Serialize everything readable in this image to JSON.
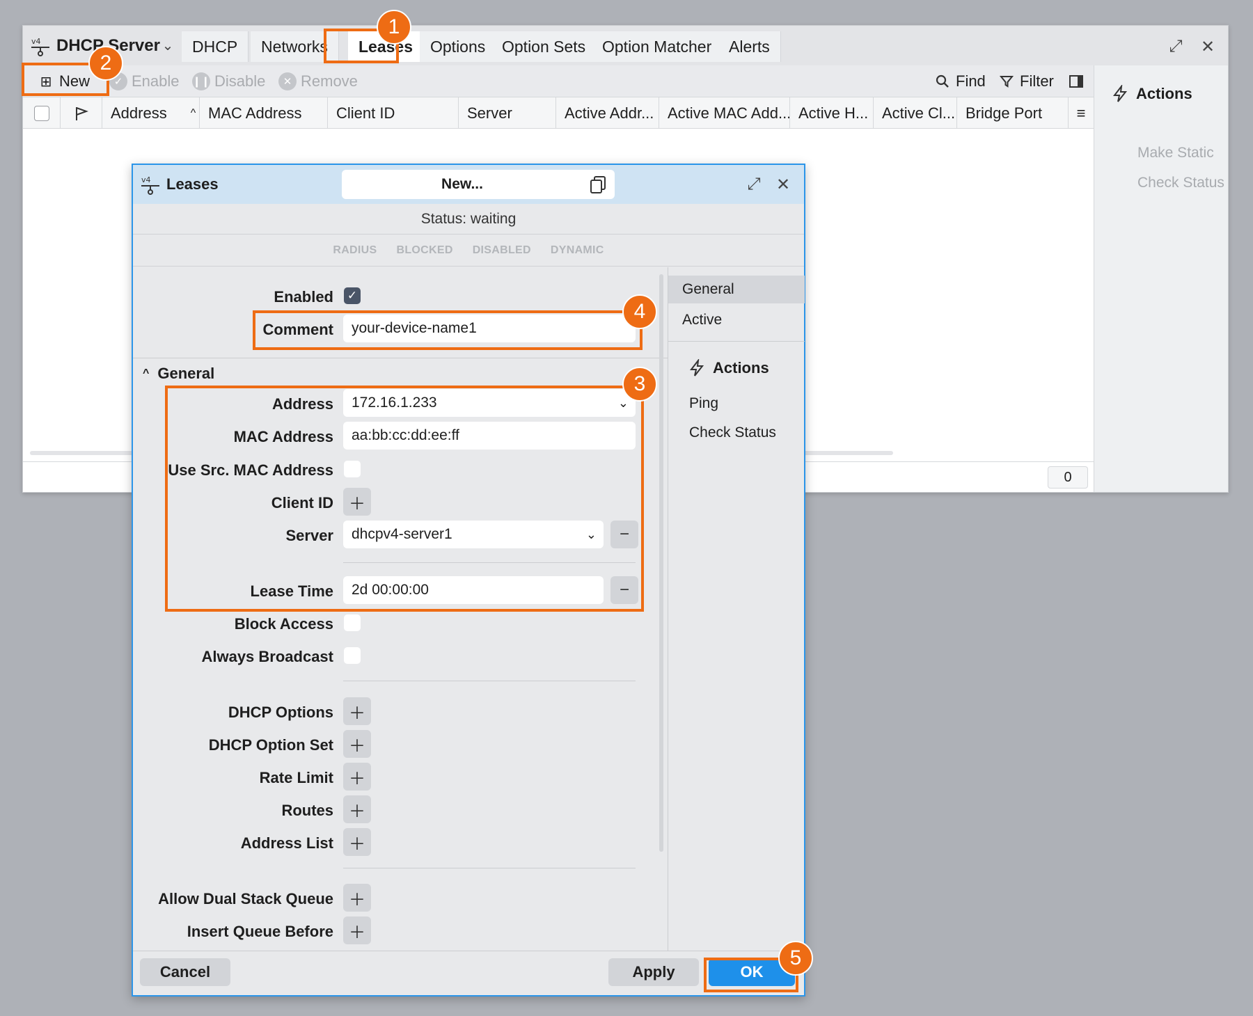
{
  "main": {
    "title": "DHCP Server",
    "tabs": [
      "DHCP",
      "Networks",
      "Leases",
      "Options",
      "Option Sets",
      "Option Matcher",
      "Alerts"
    ],
    "active_tab": "Leases",
    "toolbar": {
      "new": "New",
      "enable": "Enable",
      "disable": "Disable",
      "remove": "Remove",
      "find": "Find",
      "filter": "Filter"
    },
    "columns": [
      "Address",
      "MAC Address",
      "Client ID",
      "Server",
      "Active Addr...",
      "Active MAC Add...",
      "Active H...",
      "Active Cl...",
      "Bridge Port"
    ],
    "side_panel": {
      "header": "Actions",
      "items": [
        "Make Static",
        "Check Status"
      ]
    },
    "row_count": "0"
  },
  "dialog": {
    "title": "Leases",
    "name": "New...",
    "status": "Status: waiting",
    "flags": [
      "RADIUS",
      "BLOCKED",
      "DISABLED",
      "DYNAMIC"
    ],
    "fields": {
      "enabled_label": "Enabled",
      "comment_label": "Comment",
      "comment_value": "your-device-name1",
      "section_general": "General",
      "address_label": "Address",
      "address_value": "172.16.1.233",
      "mac_label": "MAC Address",
      "mac_value": "aa:bb:cc:dd:ee:ff",
      "use_src_mac_label": "Use Src. MAC Address",
      "client_id_label": "Client ID",
      "server_label": "Server",
      "server_value": "dhcpv4-server1",
      "lease_time_label": "Lease Time",
      "lease_time_value": "2d 00:00:00",
      "block_access_label": "Block Access",
      "always_broadcast_label": "Always Broadcast",
      "dhcp_options_label": "DHCP Options",
      "dhcp_option_set_label": "DHCP Option Set",
      "rate_limit_label": "Rate Limit",
      "routes_label": "Routes",
      "address_list_label": "Address List",
      "allow_dual_stack_label": "Allow Dual Stack Queue",
      "insert_queue_before_label": "Insert Queue Before"
    },
    "nav": [
      "General",
      "Active"
    ],
    "actions_header": "Actions",
    "actions": [
      "Ping",
      "Check Status"
    ],
    "buttons": {
      "cancel": "Cancel",
      "apply": "Apply",
      "ok": "OK"
    }
  },
  "callouts": [
    "1",
    "2",
    "3",
    "4",
    "5"
  ],
  "colors": {
    "highlight": "#ee6c14",
    "ok_button": "#1e90ea",
    "dialog_titlebar": "#cfe3f3"
  }
}
